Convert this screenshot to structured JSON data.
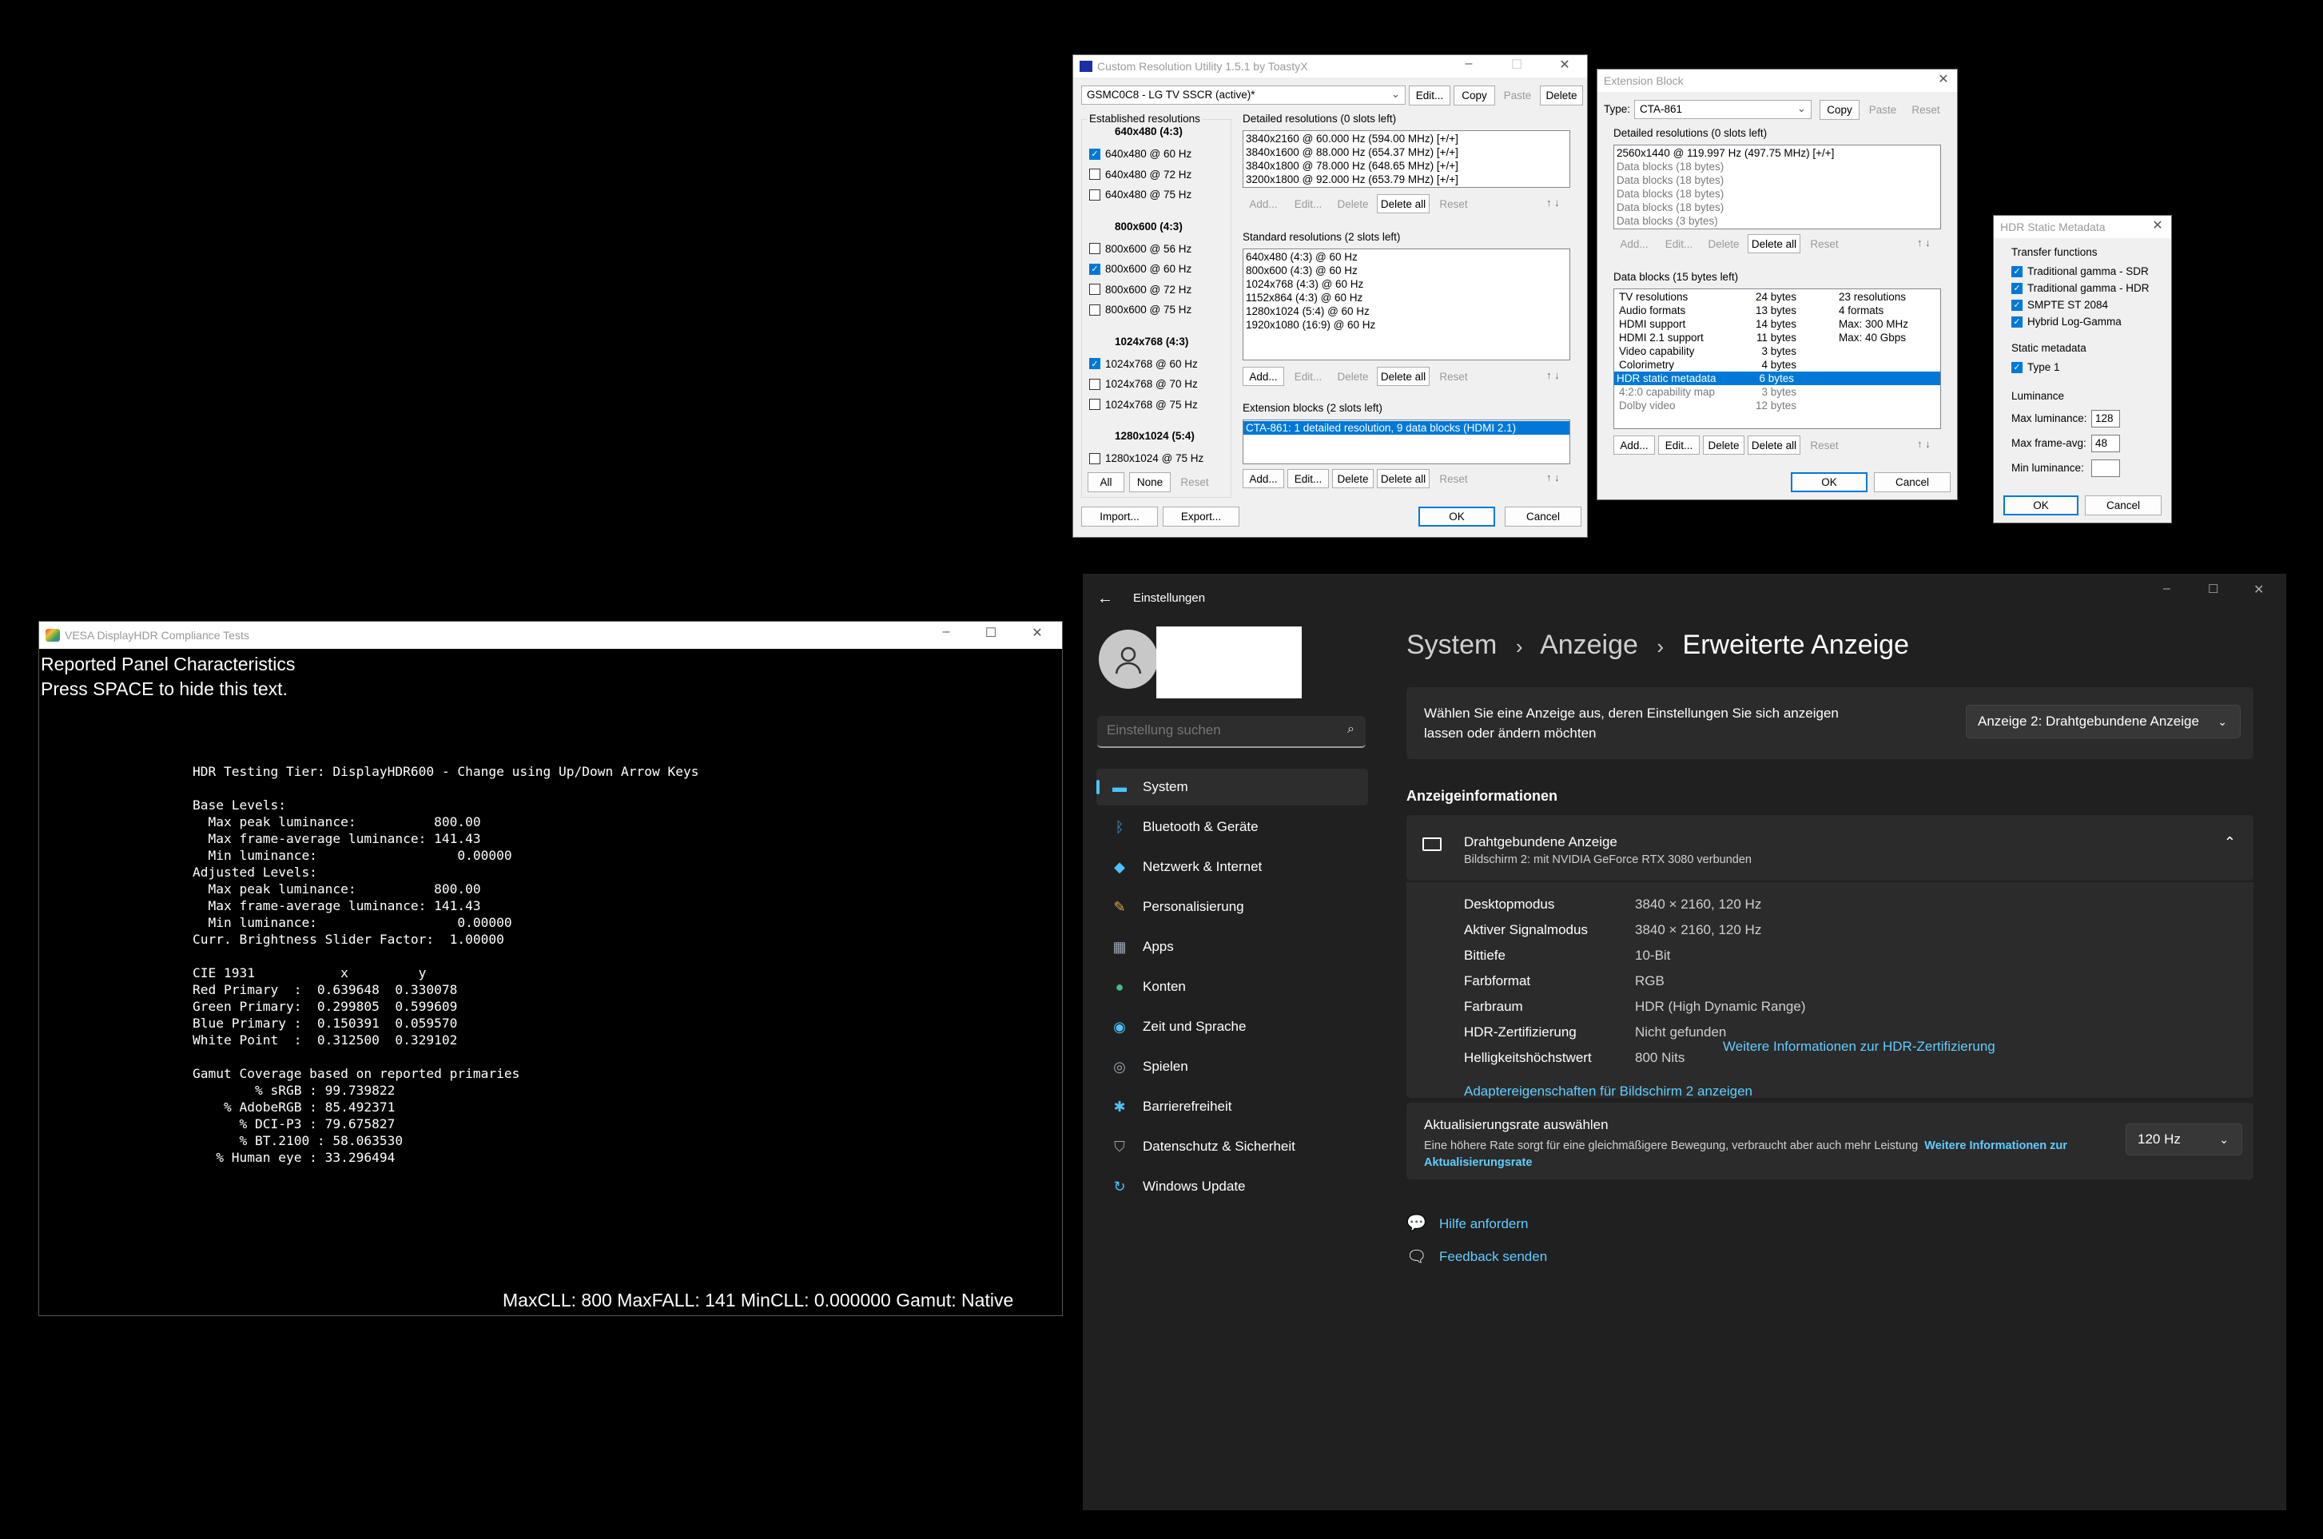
{
  "cru": {
    "title": "Custom Resolution Utility 1.5.1 by ToastyX",
    "monitor": "GSMC0C8 - LG TV SSCR (active)*",
    "top_buttons": [
      "Edit...",
      "Copy",
      "Paste",
      "Delete"
    ],
    "established_label": "Established resolutions",
    "est_groups": [
      {
        "header": "640x480 (4:3)",
        "items": [
          {
            "label": "640x480 @ 60 Hz",
            "checked": true
          },
          {
            "label": "640x480 @ 72 Hz",
            "checked": false
          },
          {
            "label": "640x480 @ 75 Hz",
            "checked": false
          }
        ]
      },
      {
        "header": "800x600 (4:3)",
        "items": [
          {
            "label": "800x600 @ 56 Hz",
            "checked": false
          },
          {
            "label": "800x600 @ 60 Hz",
            "checked": true
          },
          {
            "label": "800x600 @ 72 Hz",
            "checked": false
          },
          {
            "label": "800x600 @ 75 Hz",
            "checked": false
          }
        ]
      },
      {
        "header": "1024x768 (4:3)",
        "items": [
          {
            "label": "1024x768 @ 60 Hz",
            "checked": true
          },
          {
            "label": "1024x768 @ 70 Hz",
            "checked": false
          },
          {
            "label": "1024x768 @ 75 Hz",
            "checked": false
          }
        ]
      },
      {
        "header": "1280x1024 (5:4)",
        "items": [
          {
            "label": "1280x1024 @ 75 Hz",
            "checked": false
          }
        ]
      }
    ],
    "est_buttons": [
      "All",
      "None",
      "Reset"
    ],
    "detailed_label": "Detailed resolutions (0 slots left)",
    "detailed": [
      "3840x2160 @ 60.000 Hz (594.00 MHz) [+/+]",
      "3840x1600 @ 88.000 Hz (654.37 MHz) [+/+]",
      "3840x1800 @ 78.000 Hz (648.65 MHz) [+/+]",
      "3200x1800 @ 92.000 Hz (653.79 MHz) [+/+]"
    ],
    "standard_label": "Standard resolutions (2 slots left)",
    "standard": [
      "640x480 (4:3) @ 60 Hz",
      "800x600 (4:3) @ 60 Hz",
      "1024x768 (4:3) @ 60 Hz",
      "1152x864 (4:3) @ 60 Hz",
      "1280x1024 (5:4) @ 60 Hz",
      "1920x1080 (16:9) @ 60 Hz"
    ],
    "extension_label": "Extension blocks (2 slots left)",
    "extension": [
      "CTA-861: 1 detailed resolution, 9 data blocks (HDMI 2.1)"
    ],
    "row_buttons": [
      "Add...",
      "Edit...",
      "Delete",
      "Delete all",
      "Reset"
    ],
    "import": "Import...",
    "export": "Export...",
    "ok": "OK",
    "cancel": "Cancel"
  },
  "ext": {
    "title": "Extension Block",
    "type_label": "Type:",
    "type_value": "CTA-861",
    "buttons_top": [
      "Copy",
      "Paste",
      "Reset"
    ],
    "detailed_label": "Detailed resolutions (0 slots left)",
    "detailed": [
      "2560x1440 @ 119.997 Hz (497.75 MHz) [+/+]",
      "Data blocks (18 bytes)",
      "Data blocks (18 bytes)",
      "Data blocks (18 bytes)",
      "Data blocks (18 bytes)",
      "Data blocks (3 bytes)"
    ],
    "blocks_label": "Data blocks (15 bytes left)",
    "blocks": [
      {
        "name": "TV resolutions",
        "size": "24 bytes",
        "info": "23 resolutions"
      },
      {
        "name": "Audio formats",
        "size": "13 bytes",
        "info": "4 formats"
      },
      {
        "name": "HDMI support",
        "size": "14 bytes",
        "info": "Max: 300 MHz"
      },
      {
        "name": "HDMI 2.1 support",
        "size": "11 bytes",
        "info": "Max: 40 Gbps"
      },
      {
        "name": "Video capability",
        "size": "3 bytes",
        "info": ""
      },
      {
        "name": "Colorimetry",
        "size": "4 bytes",
        "info": ""
      },
      {
        "name": "HDR static metadata",
        "size": "6 bytes",
        "info": ""
      },
      {
        "name": "4:2:0 capability map",
        "size": "3 bytes",
        "info": ""
      },
      {
        "name": "Dolby video",
        "size": "12 bytes",
        "info": ""
      }
    ],
    "row_buttons": [
      "Add...",
      "Edit...",
      "Delete",
      "Delete all",
      "Reset"
    ],
    "ok": "OK",
    "cancel": "Cancel"
  },
  "hdr": {
    "title": "HDR Static Metadata",
    "transfer_label": "Transfer functions",
    "transfer": [
      "Traditional gamma - SDR",
      "Traditional gamma - HDR",
      "SMPTE ST 2084",
      "Hybrid Log-Gamma"
    ],
    "static_label": "Static metadata",
    "static": [
      "Type 1"
    ],
    "lum_label": "Luminance",
    "max_lum_label": "Max luminance:",
    "max_lum": "128",
    "max_avg_label": "Max frame-avg:",
    "max_avg": "48",
    "min_lum_label": "Min luminance:",
    "min_lum": "",
    "ok": "OK",
    "cancel": "Cancel"
  },
  "vesa": {
    "title": "VESA DisplayHDR Compliance Tests",
    "heading1": "Reported Panel Characteristics",
    "heading2": "Press SPACE to hide this text.",
    "console": [
      "HDR Testing Tier: DisplayHDR600 - Change using Up/Down Arrow Keys",
      "",
      "Base Levels:",
      "  Max peak luminance:          800.00",
      "  Max frame-average luminance: 141.43",
      "  Min luminance:                  0.00000",
      "Adjusted Levels:",
      "  Max peak luminance:          800.00",
      "  Max frame-average luminance: 141.43",
      "  Min luminance:                  0.00000",
      "Curr. Brightness Slider Factor:  1.00000",
      "",
      "CIE 1931           x         y",
      "Red Primary  :  0.639648  0.330078",
      "Green Primary:  0.299805  0.599609",
      "Blue Primary :  0.150391  0.059570",
      "White Point  :  0.312500  0.329102",
      "",
      "Gamut Coverage based on reported primaries",
      "        % sRGB : 99.739822",
      "    % AdobeRGB : 85.492371",
      "      % DCI-P3 : 79.675827",
      "      % BT.2100 : 58.063530",
      "   % Human eye : 33.296494"
    ],
    "status": "MaxCLL: 800  MaxFALL: 141  MinCLL: 0.000000  Gamut: Native"
  },
  "settings": {
    "app_title": "Einstellungen",
    "search_placeholder": "Einstellung suchen",
    "nav": [
      {
        "label": "System",
        "icon": "monitor-icon",
        "color": "#4cc2ff"
      },
      {
        "label": "Bluetooth & Geräte",
        "icon": "bluetooth-icon",
        "color": "#3a96dd"
      },
      {
        "label": "Netzwerk & Internet",
        "icon": "wifi-icon",
        "color": "#4cc2ff"
      },
      {
        "label": "Personalisierung",
        "icon": "brush-icon",
        "color": "#e8a33d"
      },
      {
        "label": "Apps",
        "icon": "apps-icon",
        "color": "#9aa7b5"
      },
      {
        "label": "Konten",
        "icon": "person-icon",
        "color": "#3fbf7f"
      },
      {
        "label": "Zeit und Sprache",
        "icon": "globe-clock-icon",
        "color": "#4cc2ff"
      },
      {
        "label": "Spielen",
        "icon": "gamepad-icon",
        "color": "#9aa7b5"
      },
      {
        "label": "Barrierefreiheit",
        "icon": "accessibility-icon",
        "color": "#4cc2ff"
      },
      {
        "label": "Datenschutz & Sicherheit",
        "icon": "shield-icon",
        "color": "#9aa7b5"
      },
      {
        "label": "Windows Update",
        "icon": "update-icon",
        "color": "#4cc2ff"
      }
    ],
    "breadcrumb": [
      "System",
      "Anzeige",
      "Erweiterte Anzeige"
    ],
    "select_text": "Wählen Sie eine Anzeige aus, deren Einstellungen Sie sich anzeigen lassen oder ändern möchten",
    "select_value": "Anzeige 2: Drahtgebundene Anzeige",
    "info_heading": "Anzeigeinformationen",
    "display_name": "Drahtgebundene Anzeige",
    "display_sub": "Bildschirm 2: mit NVIDIA GeForce RTX 3080 verbunden",
    "props": [
      {
        "k": "Desktopmodus",
        "v": "3840 × 2160, 120 Hz"
      },
      {
        "k": "Aktiver Signalmodus",
        "v": "3840 × 2160, 120 Hz"
      },
      {
        "k": "Bittiefe",
        "v": "10-Bit"
      },
      {
        "k": "Farbformat",
        "v": "RGB"
      },
      {
        "k": "Farbraum",
        "v": "HDR (High Dynamic Range)"
      },
      {
        "k": "HDR-Zertifizierung",
        "v": "Nicht gefunden"
      },
      {
        "k": "Helligkeitshöchstwert",
        "v": "800 Nits"
      }
    ],
    "hdr_link": "Weitere Informationen zur HDR-Zertifizierung",
    "adapter_link": "Adaptereigenschaften für Bildschirm 2 anzeigen",
    "refresh_title": "Aktualisierungsrate auswählen",
    "refresh_desc": "Eine höhere Rate sorgt für eine gleichmäßigere Bewegung, verbraucht aber auch mehr Leistung",
    "refresh_link": "Weitere Informationen zur Aktualisierungsrate",
    "refresh_value": "120 Hz",
    "help": "Hilfe anfordern",
    "feedback": "Feedback senden"
  }
}
